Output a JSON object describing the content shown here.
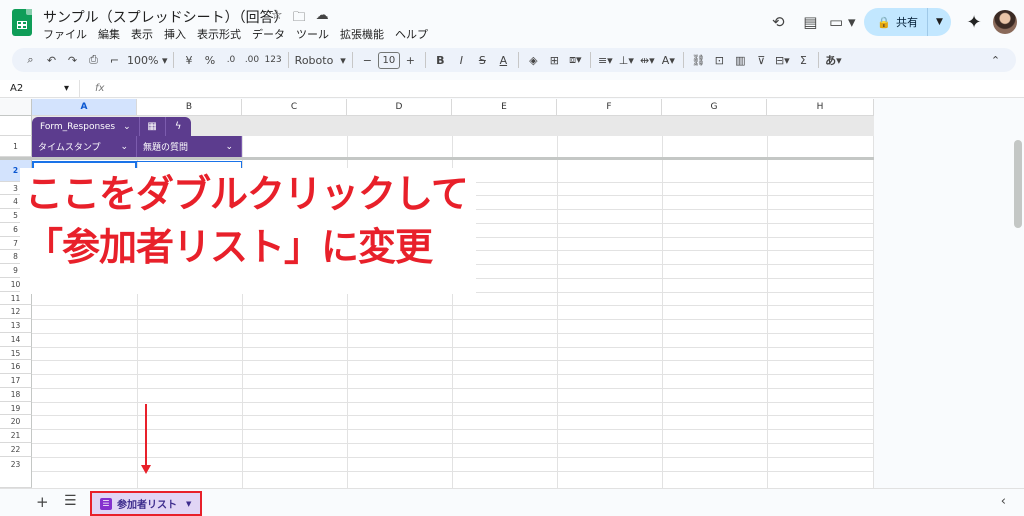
{
  "header": {
    "title": "サンプル（スプレッドシート）（回答）",
    "menu": [
      "ファイル",
      "編集",
      "表示",
      "挿入",
      "表示形式",
      "データ",
      "ツール",
      "拡張機能",
      "ヘルプ"
    ],
    "share_label": "共有"
  },
  "toolbar": {
    "zoom": "100%",
    "currency": "¥",
    "percent": "%",
    "dec_decrease": ".0",
    "dec_increase": ".00",
    "number_format": "123",
    "font": "Roboto",
    "font_size": "10",
    "bold": "B",
    "italic": "I",
    "strike": "S",
    "text_color": "A",
    "input_tool": "あ"
  },
  "formula_bar": {
    "cell_ref": "A2",
    "fx": "fx"
  },
  "grid": {
    "columns": [
      "A",
      "B",
      "C",
      "D",
      "E",
      "F",
      "G",
      "H"
    ],
    "rows": [
      "1",
      "2",
      "3",
      "4",
      "5",
      "6",
      "7",
      "8",
      "9",
      "10",
      "11",
      "12",
      "13",
      "14",
      "15",
      "16",
      "17",
      "18",
      "19",
      "20",
      "21",
      "22",
      "23"
    ],
    "table_name": "Form_Responses",
    "table_headers": [
      "タイムスタンプ",
      "無題の質問"
    ]
  },
  "annotation": {
    "line1": "ここをダブルクリックして",
    "line2": "「参加者リスト」に変更"
  },
  "sheet_tab": {
    "label": "参加者リスト"
  },
  "colors": {
    "table_purple": "#5c3c8e",
    "annotation_red": "#e8202a",
    "selection_blue": "#1a73e8",
    "share_bg": "#c2e7ff"
  }
}
